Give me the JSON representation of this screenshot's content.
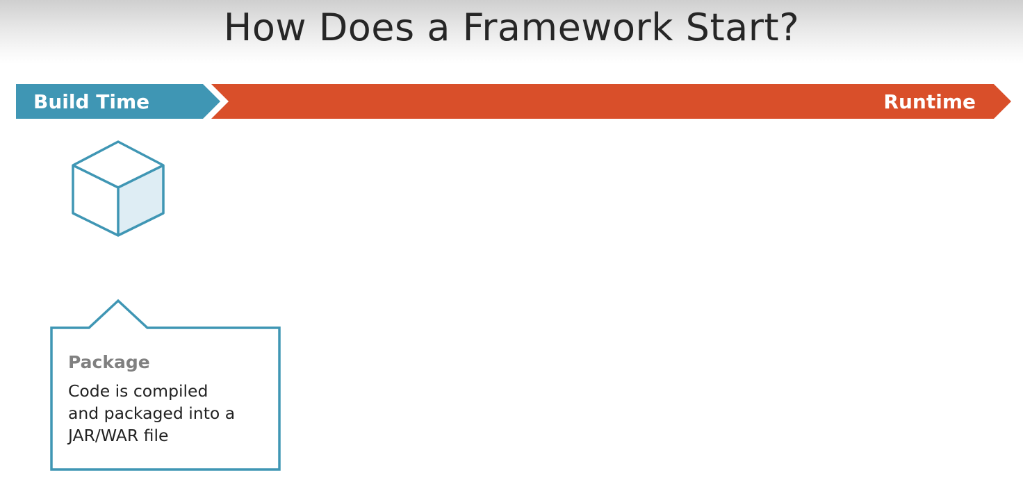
{
  "title": "How Does a Framework Start?",
  "timeline": {
    "build_label": "Build Time",
    "runtime_label": "Runtime",
    "build_color": "#3f96b4",
    "runtime_color": "#d94f2a"
  },
  "package_icon": {
    "icon": "cube-icon",
    "stroke_color": "#3f96b4",
    "shaded_face_color": "#deedf4"
  },
  "callout": {
    "heading": "Package",
    "body_lines": [
      "Code is compiled",
      "and packaged into a",
      "JAR/WAR file"
    ],
    "border_color": "#3f96b4"
  }
}
